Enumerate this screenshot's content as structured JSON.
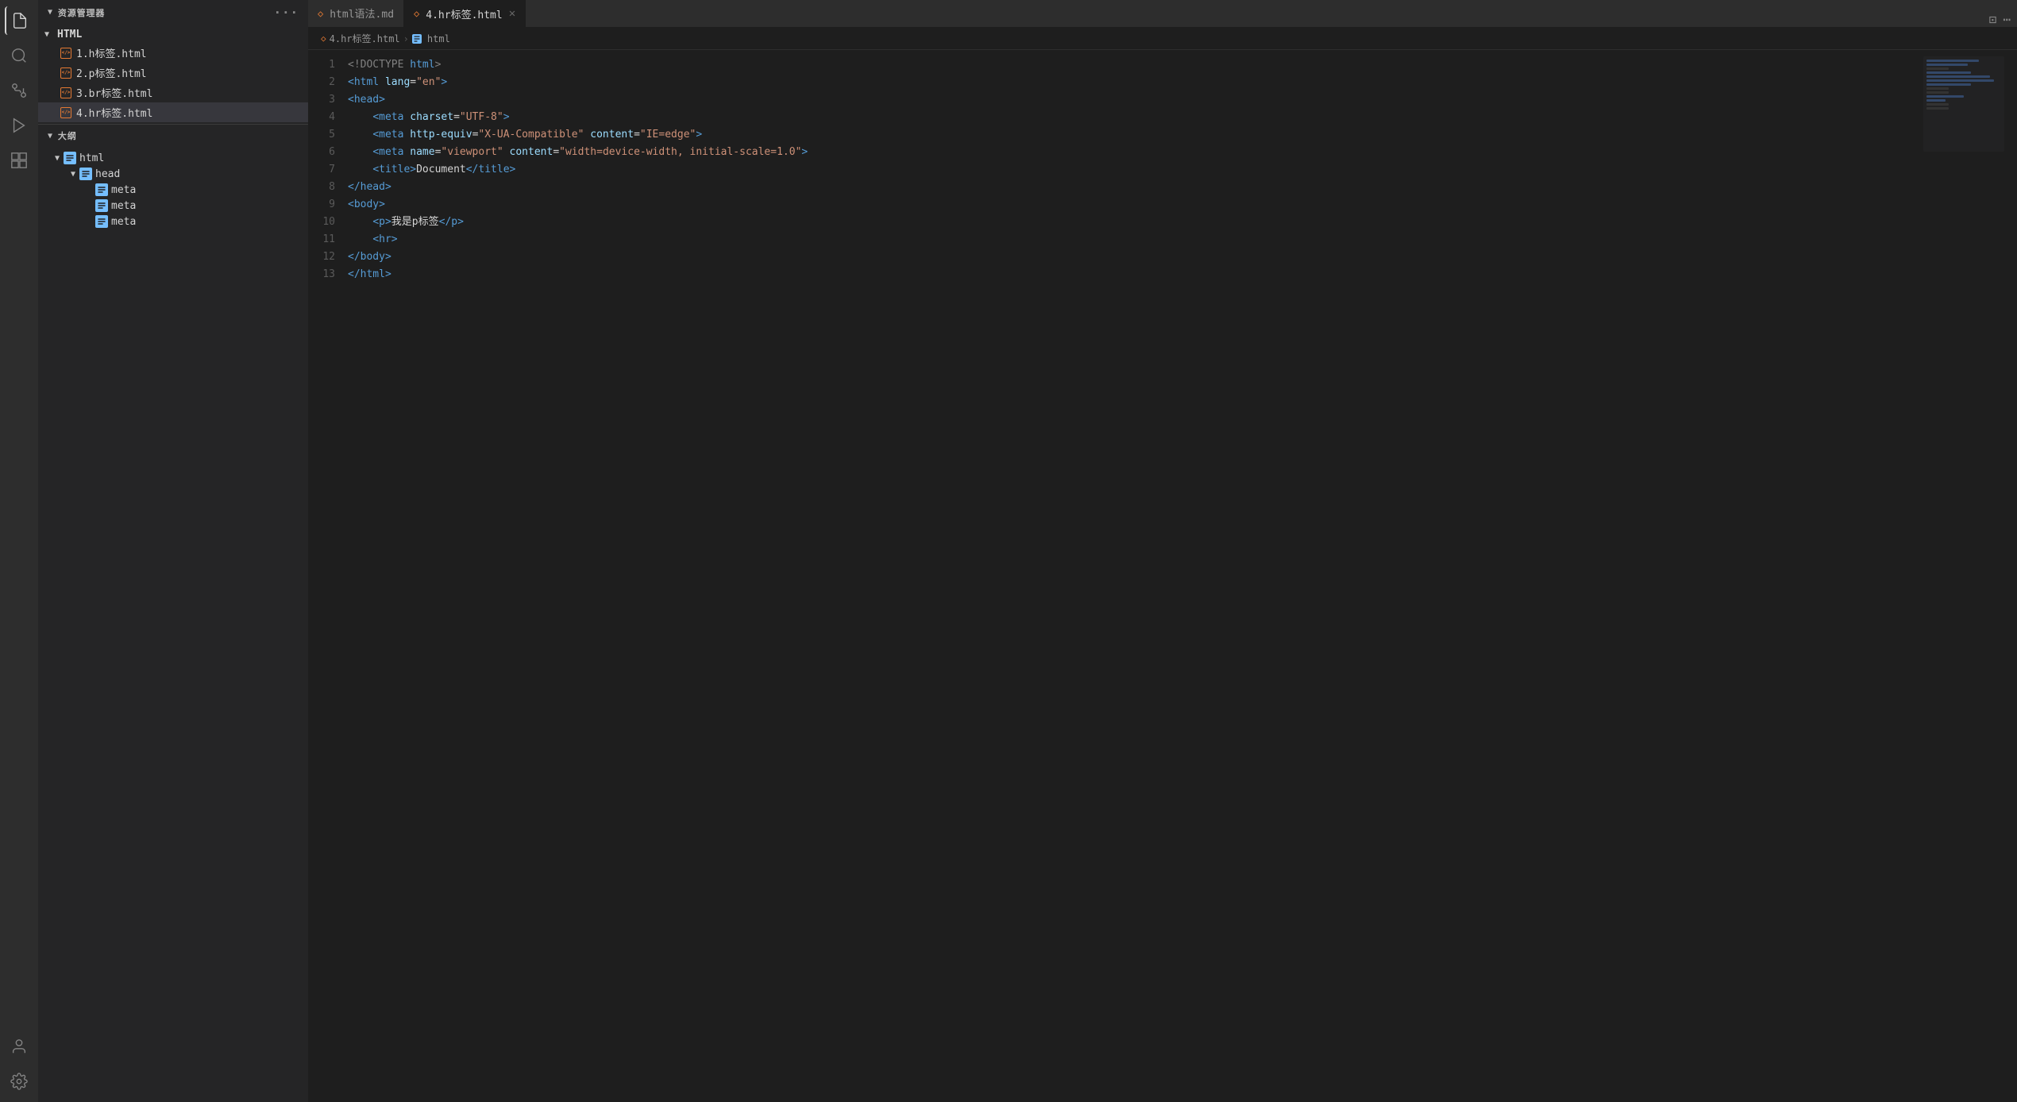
{
  "activityBar": {
    "icons": [
      {
        "name": "files-icon",
        "symbol": "⧉",
        "active": true
      },
      {
        "name": "search-icon",
        "symbol": "🔍"
      },
      {
        "name": "source-control-icon",
        "symbol": "⑂"
      },
      {
        "name": "run-icon",
        "symbol": "▶"
      },
      {
        "name": "extensions-icon",
        "symbol": "⊞"
      }
    ],
    "bottomIcons": [
      {
        "name": "account-icon",
        "symbol": "👤"
      },
      {
        "name": "settings-icon",
        "symbol": "⚙"
      }
    ]
  },
  "sidebar": {
    "explorerTitle": "资源管理器",
    "explorerMore": "···",
    "folderName": "HTML",
    "files": [
      {
        "id": "file1",
        "name": "1.h标签.html",
        "active": false
      },
      {
        "id": "file2",
        "name": "2.p标签.html",
        "active": false
      },
      {
        "id": "file3",
        "name": "3.br标签.html",
        "active": false
      },
      {
        "id": "file4",
        "name": "4.hr标签.html",
        "active": true
      }
    ],
    "outlineTitle": "大纲",
    "outline": [
      {
        "id": "html-node",
        "label": "html",
        "level": 1,
        "hasChevron": true,
        "expanded": true
      },
      {
        "id": "head-node",
        "label": "head",
        "level": 2,
        "hasChevron": true,
        "expanded": true
      },
      {
        "id": "meta1-node",
        "label": "meta",
        "level": 3,
        "hasChevron": false
      },
      {
        "id": "meta2-node",
        "label": "meta",
        "level": 3,
        "hasChevron": false
      },
      {
        "id": "meta3-node",
        "label": "meta",
        "level": 3,
        "hasChevron": false
      }
    ]
  },
  "tabs": [
    {
      "id": "tab1",
      "label": "html语法.md",
      "icon": "◇",
      "active": false,
      "closable": false
    },
    {
      "id": "tab2",
      "label": "4.hr标签.html",
      "icon": "◇",
      "active": true,
      "closable": true
    }
  ],
  "breadcrumb": {
    "items": [
      {
        "label": "4.hr标签.html",
        "icon": true
      },
      {
        "label": "html",
        "icon": false
      }
    ]
  },
  "code": {
    "lines": [
      {
        "num": 1,
        "html": "<span class='c-doctype'>&lt;!DOCTYPE </span><span class='c-doctype-kw'>html</span><span class='c-doctype'>&gt;</span>"
      },
      {
        "num": 2,
        "html": "<span class='c-tag'>&lt;html</span> <span class='c-attr'>lang</span><span class='c-text'>=</span><span class='c-string'>\"en\"</span><span class='c-tag'>&gt;</span>"
      },
      {
        "num": 3,
        "html": "<span class='c-tag'>&lt;head&gt;</span>"
      },
      {
        "num": 4,
        "html": "    <span class='c-tag'>&lt;meta</span> <span class='c-attr'>charset</span><span class='c-text'>=</span><span class='c-string'>\"UTF-8\"</span><span class='c-tag'>&gt;</span>"
      },
      {
        "num": 5,
        "html": "    <span class='c-tag'>&lt;meta</span> <span class='c-attr'>http-equiv</span><span class='c-text'>=</span><span class='c-string'>\"X-UA-Compatible\"</span> <span class='c-attr'>content</span><span class='c-text'>=</span><span class='c-string'>\"IE=edge\"</span><span class='c-tag'>&gt;</span>"
      },
      {
        "num": 6,
        "html": "    <span class='c-tag'>&lt;meta</span> <span class='c-attr'>name</span><span class='c-text'>=</span><span class='c-string'>\"viewport\"</span> <span class='c-attr'>content</span><span class='c-text'>=</span><span class='c-string'>\"width=device-width, initial-scale=1.0\"</span><span class='c-tag'>&gt;</span>"
      },
      {
        "num": 7,
        "html": "    <span class='c-tag'>&lt;title&gt;</span><span class='c-text'>Document</span><span class='c-tag'>&lt;/title&gt;</span>"
      },
      {
        "num": 8,
        "html": "<span class='c-tag'>&lt;/head&gt;</span>"
      },
      {
        "num": 9,
        "html": "<span class='c-tag'>&lt;body&gt;</span>"
      },
      {
        "num": 10,
        "html": "    <span class='c-tag'>&lt;p&gt;</span><span class='c-text'>我是p标签</span><span class='c-tag'>&lt;/p&gt;</span>"
      },
      {
        "num": 11,
        "html": "    <span class='c-tag'>&lt;hr&gt;</span>"
      },
      {
        "num": 12,
        "html": "<span class='c-tag'>&lt;/body&gt;</span>"
      },
      {
        "num": 13,
        "html": "<span class='c-tag'>&lt;/html&gt;</span>"
      }
    ]
  }
}
